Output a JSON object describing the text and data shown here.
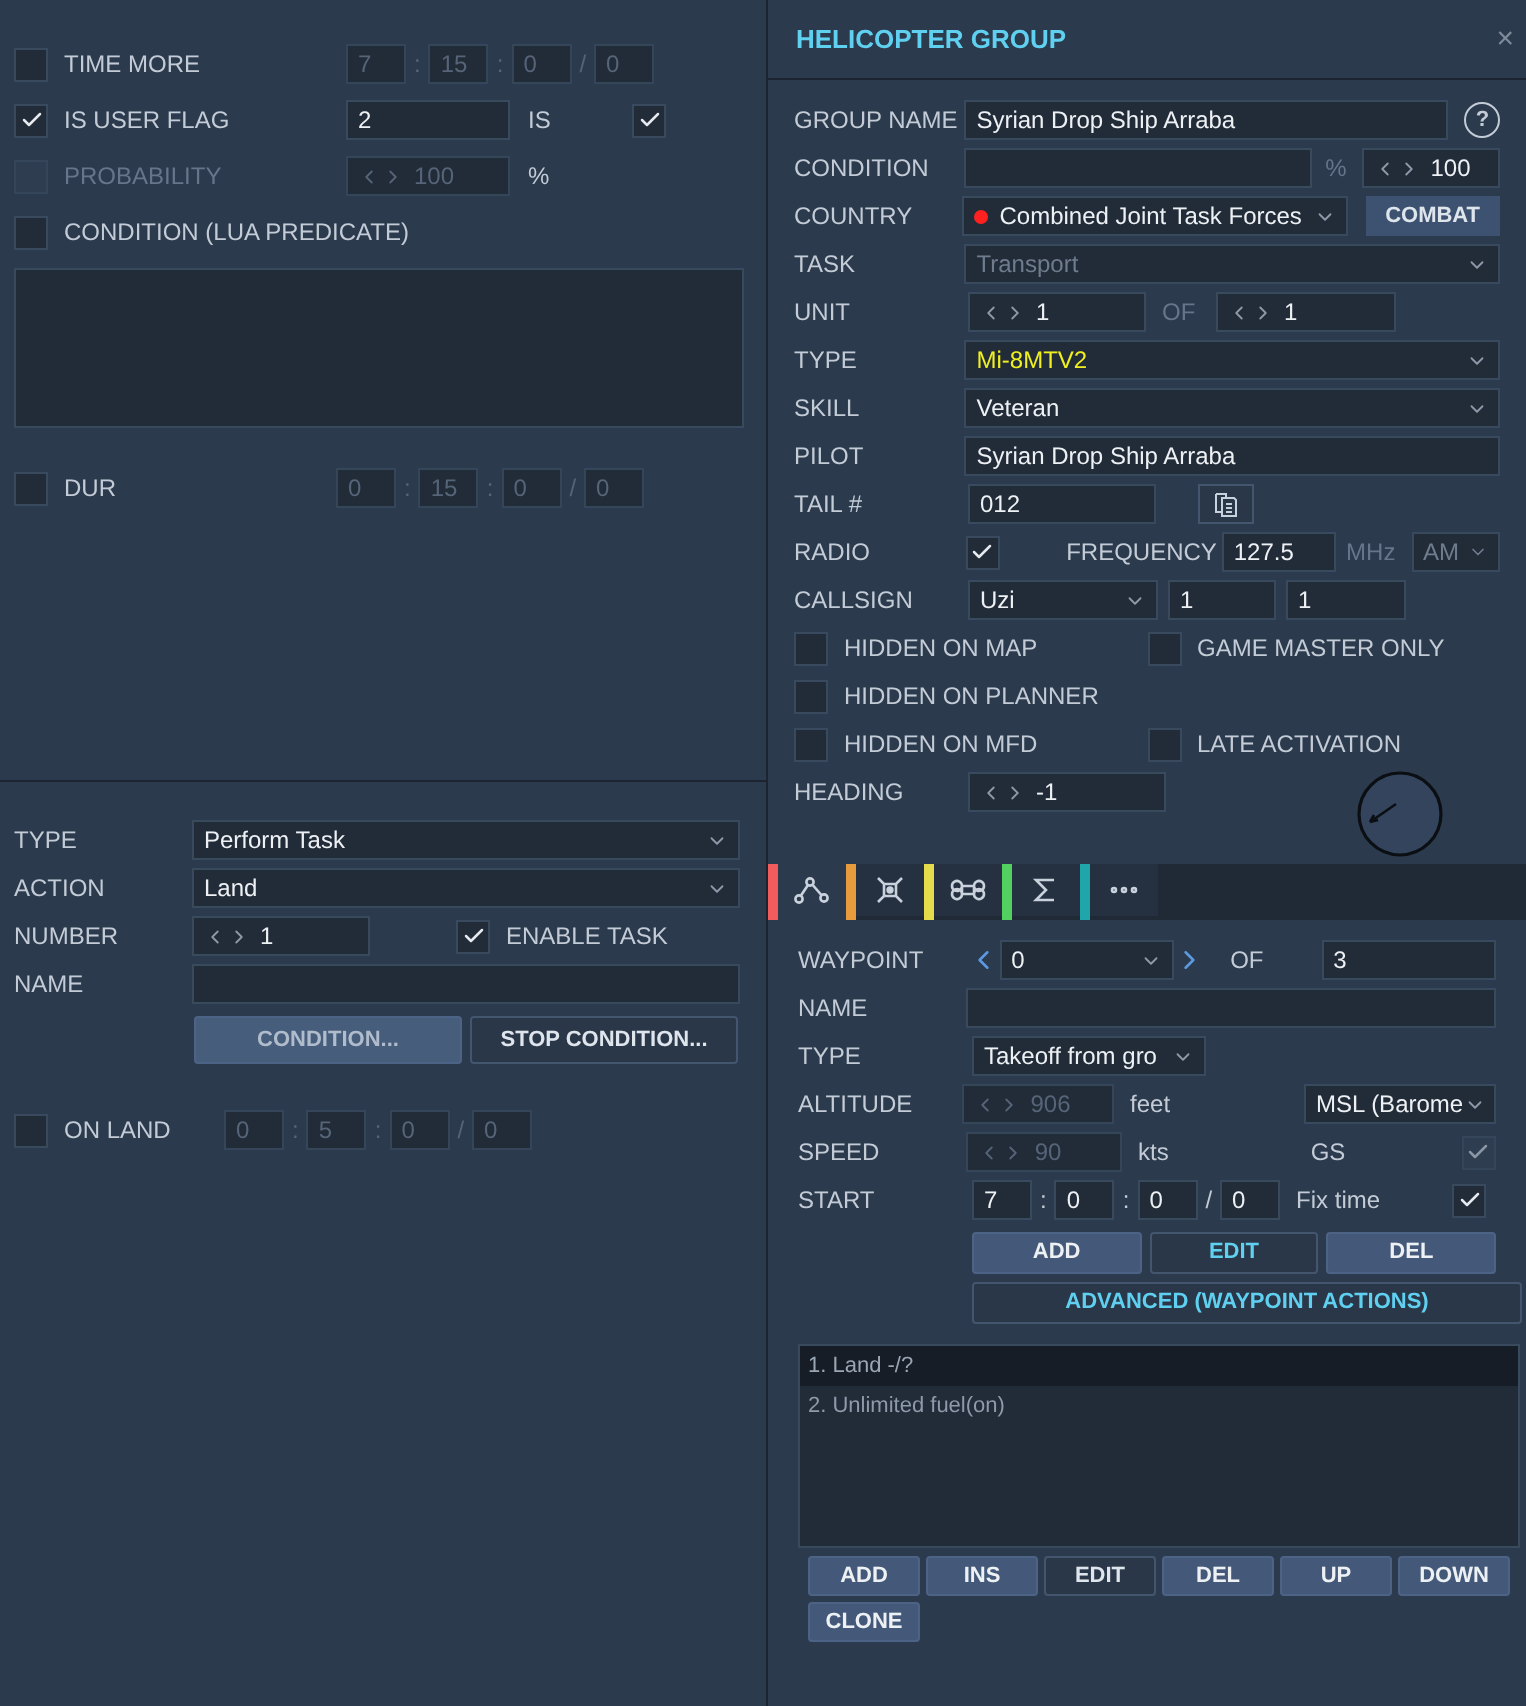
{
  "left_top": {
    "time_more": {
      "label": "TIME MORE",
      "checked": false,
      "fields": [
        "7",
        "15",
        "0",
        "0"
      ],
      "separators": [
        ":",
        ":",
        "/"
      ]
    },
    "user_flag": {
      "label": "IS USER FLAG",
      "checked": true,
      "value": "2",
      "is_label": "IS",
      "is_checked": true
    },
    "probability": {
      "label": "PROBABILITY",
      "checked": false,
      "disabled": true,
      "value": "100",
      "unit": "%"
    },
    "lua_condition": {
      "label": "CONDITION (LUA PREDICATE)",
      "checked": false
    },
    "dur": {
      "label": "DUR",
      "checked": false,
      "fields": [
        "0",
        "15",
        "0",
        "0"
      ],
      "separators": [
        ":",
        ":",
        "/"
      ]
    }
  },
  "task": {
    "type_label": "TYPE",
    "type": "Perform Task",
    "action_label": "ACTION",
    "action": "Land",
    "number_label": "NUMBER",
    "number": "1",
    "enable_label": "ENABLE TASK",
    "enabled": true,
    "name_label": "NAME",
    "buttons": [
      {
        "label": "CONDITION...",
        "kind": "filled"
      },
      {
        "label": "STOP CONDITION...",
        "kind": "outline"
      }
    ],
    "on_land": {
      "label": "ON LAND",
      "checked": false,
      "fields": [
        "0",
        "5",
        "0",
        "0"
      ],
      "separators": [
        ":",
        ":",
        "/"
      ]
    }
  },
  "group": {
    "title": "HELICOPTER GROUP",
    "close": "×",
    "help": "?",
    "group_name": {
      "label": "GROUP NAME",
      "value": "Syrian Drop Ship Arraba"
    },
    "condition": {
      "label": "CONDITION",
      "unit": "%",
      "value": "100"
    },
    "country": {
      "label": "COUNTRY",
      "value": "Combined Joint Task Forces",
      "button": "COMBAT"
    },
    "task": {
      "label": "TASK",
      "value": "Transport",
      "disabled": true
    },
    "unit": {
      "label": "UNIT",
      "value": "1",
      "of_label": "OF",
      "total": "1"
    },
    "type": {
      "label": "TYPE",
      "value": "Mi-8MTV2"
    },
    "skill": {
      "label": "SKILL",
      "value": "Veteran"
    },
    "pilot": {
      "label": "PILOT",
      "value": "Syrian Drop Ship Arraba"
    },
    "tail": {
      "label": "TAIL #",
      "value": "012"
    },
    "radio": {
      "label": "RADIO",
      "checked": true,
      "frequency_label": "FREQUENCY",
      "frequency": "127.5",
      "unit": "MHz",
      "modulation": "AM",
      "modulation_disabled": true
    },
    "callsign": {
      "label": "CALLSIGN",
      "value": "Uzi",
      "number_1": "1",
      "number_2": "1"
    },
    "option_rows": [
      [
        {
          "label": "HIDDEN ON MAP",
          "checked": false
        },
        {
          "label": "GAME MASTER ONLY",
          "checked": false
        }
      ],
      [
        {
          "label": "HIDDEN ON PLANNER",
          "checked": false
        }
      ],
      [
        {
          "label": "HIDDEN ON MFD",
          "checked": false
        },
        {
          "label": "LATE ACTIVATION",
          "checked": false
        }
      ]
    ],
    "heading": {
      "label": "HEADING",
      "value": "-1"
    }
  },
  "tabs": [
    {
      "kind": "route",
      "color": "#f25c5c",
      "selected": true
    },
    {
      "kind": "target",
      "color": "#e89b3c",
      "selected": false
    },
    {
      "kind": "command",
      "color": "#e5dc4c",
      "selected": false
    },
    {
      "kind": "sum",
      "color": "#52d160",
      "selected": false
    },
    {
      "kind": "more",
      "color": "#1fa5aa",
      "selected": false
    }
  ],
  "waypoint": {
    "label": "WAYPOINT",
    "value": "0",
    "of_label": "OF",
    "total": "3",
    "name_label": "NAME",
    "type_label": "TYPE",
    "type": "Takeoff from gro",
    "altitude_label": "ALTITUDE",
    "altitude": "906",
    "altitude_disabled": true,
    "altitude_unit": "feet",
    "altitude_type": "MSL (Barome",
    "speed_label": "SPEED",
    "speed": "90",
    "speed_disabled": true,
    "speed_unit": "kts",
    "gs_label": "GS",
    "gs_checked": true,
    "gs_disabled": true,
    "start_label": "START",
    "start_fields": [
      "7",
      "0",
      "0",
      "0"
    ],
    "separators": [
      ":",
      ":",
      "/"
    ],
    "fix_time_label": "Fix time",
    "fix_time": true,
    "buttons": [
      {
        "label": "ADD",
        "kind": "filled"
      },
      {
        "label": "EDIT",
        "kind": "accent"
      },
      {
        "label": "DEL",
        "kind": "filled"
      }
    ],
    "advanced": "ADVANCED (WAYPOINT ACTIONS)"
  },
  "actions": {
    "items": [
      {
        "text": "1. Land -/?",
        "selected": true
      },
      {
        "text": "2. Unlimited fuel(on)",
        "selected": false
      }
    ],
    "buttons": [
      {
        "label": "ADD",
        "kind": "filled"
      },
      {
        "label": "INS",
        "kind": "filled"
      },
      {
        "label": "EDIT",
        "kind": "outline"
      },
      {
        "label": "DEL",
        "kind": "filled"
      },
      {
        "label": "UP",
        "kind": "filled"
      },
      {
        "label": "DOWN",
        "kind": "filled"
      },
      {
        "label": "CLONE",
        "kind": "filled"
      }
    ]
  }
}
